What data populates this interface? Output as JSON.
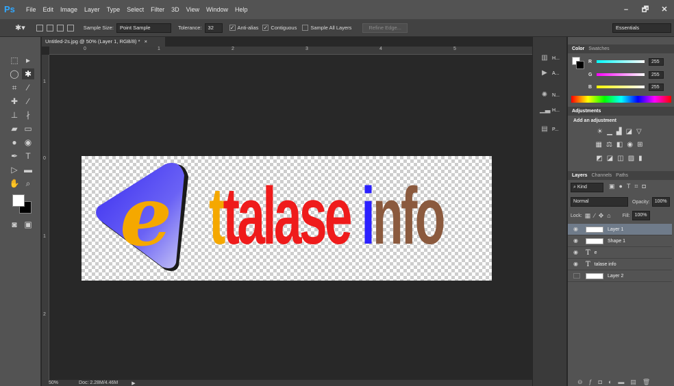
{
  "app": {
    "logo": "Ps",
    "menu": [
      "File",
      "Edit",
      "Image",
      "Layer",
      "Type",
      "Select",
      "Filter",
      "3D",
      "View",
      "Window",
      "Help"
    ],
    "window_controls": [
      "–",
      "🗗",
      "✕"
    ]
  },
  "options": {
    "sample_size_label": "Sample Size:",
    "sample_size_value": "Point Sample",
    "tolerance_label": "Tolerance:",
    "tolerance_value": "32",
    "anti_alias_label": "Anti-alias",
    "contiguous_label": "Contiguous",
    "sample_all_label": "Sample All Layers",
    "refine_edge_label": "Refine Edge...",
    "workspace_value": "Essentials"
  },
  "document": {
    "tab_title": "Untitled-2s.jpg @ 50% (Layer 1, RGB/8) *",
    "tab_close": "×",
    "logo_e": "e",
    "logo_talase": "talase",
    "logo_i": "i",
    "logo_nfo": "nfo"
  },
  "rulers": {
    "top_ticks": [
      "0",
      "1",
      "2",
      "3",
      "4",
      "5"
    ],
    "left_ticks": [
      "1",
      "0",
      "1",
      "2"
    ]
  },
  "status": {
    "zoom": "50%",
    "doc_size": "Doc: 2.28M/4.46M"
  },
  "dock": {
    "items": [
      {
        "icon": "histogram-icon",
        "label": "H..."
      },
      {
        "icon": "actions-play-icon",
        "label": "A..."
      },
      {
        "icon": "navigator-icon",
        "label": "N..."
      },
      {
        "icon": "history-icon",
        "label": "H..."
      },
      {
        "icon": "properties-icon",
        "label": "P..."
      }
    ]
  },
  "color_panel": {
    "tabs": [
      "Color",
      "Swatches"
    ],
    "channels": [
      {
        "label": "R",
        "value": "255",
        "color": "#ff0000"
      },
      {
        "label": "G",
        "value": "255",
        "color": "#00ff00"
      },
      {
        "label": "B",
        "value": "255",
        "color": "#0000ff"
      }
    ]
  },
  "adjustments": {
    "tab": "Adjustments",
    "title": "Add an adjustment"
  },
  "layers_panel": {
    "tabs": [
      "Layers",
      "Channels",
      "Paths"
    ],
    "kind_label": "Kind",
    "blend_mode": "Normal",
    "opacity_label": "Opacity:",
    "opacity_value": "100%",
    "lock_label": "Lock:",
    "fill_label": "Fill:",
    "fill_value": "100%",
    "layers": [
      {
        "name": "Layer 1",
        "selected": true,
        "visible": true,
        "type": "image"
      },
      {
        "name": "Shape 1",
        "selected": false,
        "visible": true,
        "type": "shape"
      },
      {
        "name": "e",
        "selected": false,
        "visible": true,
        "type": "text"
      },
      {
        "name": "talase info",
        "selected": false,
        "visible": true,
        "type": "text"
      },
      {
        "name": "Layer 2",
        "selected": false,
        "visible": false,
        "type": "image"
      }
    ]
  },
  "colors": {
    "logo_e_bg": "#4a3ff0",
    "logo_e": "#f5a800",
    "logo_talase": "#ef1b1b",
    "logo_i": "#2b20ff",
    "logo_nfo": "#8b5a3e",
    "selected_layer": "#6f7b8a"
  }
}
